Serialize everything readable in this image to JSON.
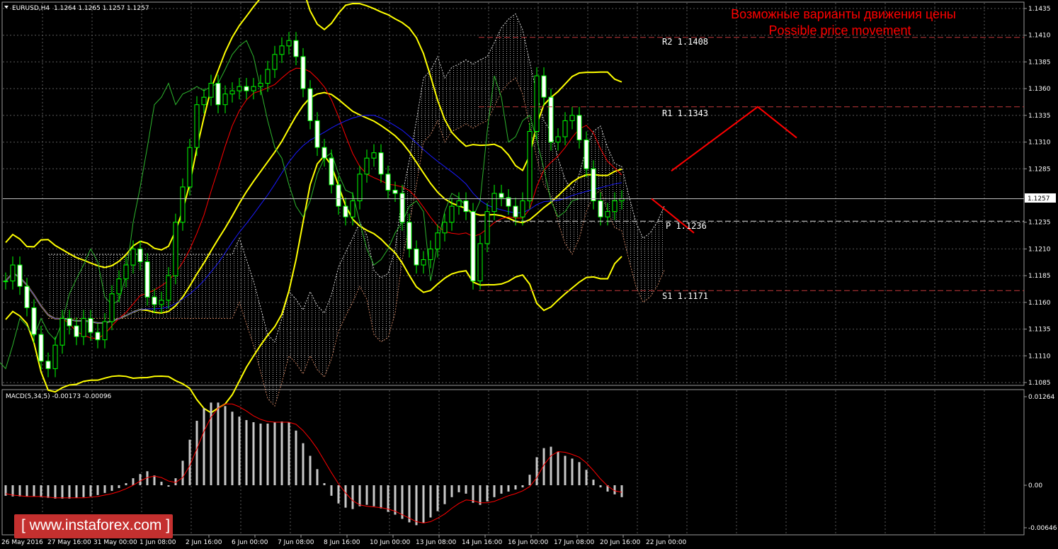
{
  "header": {
    "symbol": "EURUSD,H4",
    "ohlc": "1.1264 1.1265 1.1257 1.1257"
  },
  "annotation": {
    "line1": "Возможные варианты движения цены",
    "line2": "Possible price movement",
    "color": "#ff0000"
  },
  "levels": [
    {
      "name": "R2",
      "label": "R2  1.1408",
      "value": 1.1408
    },
    {
      "name": "R1",
      "label": "R1  1.1343",
      "value": 1.1343
    },
    {
      "name": "P",
      "label": "P  1.1236",
      "value": 1.1236
    },
    {
      "name": "S1",
      "label": "S1  1.1171",
      "value": 1.1171
    }
  ],
  "current_price": "1.1257",
  "macd_label": "MACD(5,34,5) -0.00173 -0.00096",
  "watermark": "[ www.instaforex.com ]",
  "chart_data": [
    {
      "type": "candlestick",
      "timeframe": "H4",
      "y_ticks": [
        "1.1435",
        "1.1410",
        "1.1385",
        "1.1360",
        "1.1335",
        "1.1310",
        "1.1285",
        "1.1257",
        "1.1235",
        "1.1210",
        "1.1185",
        "1.1160",
        "1.1135",
        "1.1110",
        "1.1085"
      ],
      "ylim": [
        1.1075,
        1.145
      ],
      "x_ticks": [
        "26 May 2016",
        "27 May 16:00",
        "31 May 00:00",
        "1 Jun 08:00",
        "2 Jun 16:00",
        "6 Jun 00:00",
        "7 Jun 08:00",
        "8 Jun 16:00",
        "10 Jun 00:00",
        "13 Jun 08:00",
        "14 Jun 16:00",
        "16 Jun 00:00",
        "17 Jun 08:00",
        "20 Jun 16:00",
        "22 Jun 00:00"
      ],
      "close_path": [
        1.118,
        1.1195,
        1.1175,
        1.1155,
        1.113,
        1.1105,
        1.1098,
        1.112,
        1.1145,
        1.1138,
        1.1128,
        1.1145,
        1.1132,
        1.1125,
        1.1142,
        1.1168,
        1.1182,
        1.1195,
        1.121,
        1.1198,
        1.1165,
        1.1158,
        1.1162,
        1.1185,
        1.1235,
        1.1268,
        1.1305,
        1.1345,
        1.1352,
        1.1365,
        1.1345,
        1.1355,
        1.1358,
        1.1362,
        1.1358,
        1.1362,
        1.1365,
        1.1378,
        1.1392,
        1.14,
        1.1405,
        1.139,
        1.136,
        1.133,
        1.1305,
        1.1295,
        1.127,
        1.125,
        1.124,
        1.1255,
        1.128,
        1.1295,
        1.13,
        1.128,
        1.1265,
        1.1262,
        1.1235,
        1.121,
        1.1195,
        1.12,
        1.121,
        1.1225,
        1.1235,
        1.125,
        1.1255,
        1.1245,
        1.118,
        1.1215,
        1.1245,
        1.1262,
        1.1258,
        1.125,
        1.124,
        1.1255,
        1.132,
        1.1372,
        1.1352,
        1.131,
        1.1315,
        1.133,
        1.1335,
        1.1312,
        1.1285,
        1.1255,
        1.124,
        1.1245,
        1.1255,
        1.1257
      ],
      "series": [
        {
          "name": "",
          "style": "bollinger",
          "color": "#ffff00"
        },
        {
          "name": "",
          "style": "tenkan-kijun",
          "color": "#ff0000"
        },
        {
          "name": "",
          "style": "tenkan-kijun",
          "color": "#0000ff"
        },
        {
          "name": "",
          "style": "chikou",
          "color": "#2db52d"
        }
      ],
      "forecast": [
        {
          "from": 1.1283,
          "to": 1.1343,
          "then": 1.1314
        },
        {
          "from": 1.1257,
          "to": 1.1225
        }
      ]
    },
    {
      "type": "bar",
      "y_ticks": [
        "0.01264",
        "0.00",
        "-0.00646"
      ],
      "ylim": [
        -0.0068,
        0.0128
      ],
      "values": [
        -0.0015,
        -0.0016,
        -0.0016,
        -0.0016,
        -0.0016,
        -0.0017,
        -0.0018,
        -0.0019,
        -0.0019,
        -0.0019,
        -0.0018,
        -0.0017,
        -0.0016,
        -0.0014,
        -0.0011,
        -0.0008,
        -0.0004,
        0.0003,
        0.001,
        0.0016,
        0.002,
        0.0014,
        0.0005,
        -0.0002,
        0.001,
        0.0035,
        0.0065,
        0.0092,
        0.011,
        0.0118,
        0.0118,
        0.0113,
        0.0105,
        0.0098,
        0.0093,
        0.009,
        0.0088,
        0.0088,
        0.009,
        0.0091,
        0.009,
        0.0078,
        0.006,
        0.0042,
        0.0023,
        0.0003,
        -0.0015,
        -0.0026,
        -0.0032,
        -0.0034,
        -0.003,
        -0.0028,
        -0.003,
        -0.0033,
        -0.0038,
        -0.0042,
        -0.0048,
        -0.0053,
        -0.0057,
        -0.0054,
        -0.0046,
        -0.0037,
        -0.0027,
        -0.0017,
        -0.001,
        -0.0012,
        -0.0025,
        -0.0028,
        -0.0023,
        -0.0017,
        -0.0012,
        -0.0009,
        -0.0006,
        -0.0003,
        0.0015,
        0.004,
        0.0053,
        0.0055,
        0.0048,
        0.0042,
        0.0038,
        0.0033,
        0.0022,
        0.0008,
        -0.0003,
        -0.0009,
        -0.0013,
        -0.0017
      ],
      "signal": [
        -0.0012,
        -0.0014,
        -0.0015,
        -0.0016,
        -0.0016,
        -0.0016,
        -0.0017,
        -0.0018,
        -0.0018,
        -0.0018,
        -0.0018,
        -0.0018,
        -0.0017,
        -0.0016,
        -0.0014,
        -0.0012,
        -0.0009,
        -0.0005,
        0.0,
        0.0006,
        0.0011,
        0.0013,
        0.0011,
        0.0006,
        0.0004,
        0.0011,
        0.0028,
        0.0052,
        0.0077,
        0.0097,
        0.011,
        0.0116,
        0.0116,
        0.0112,
        0.0106,
        0.0099,
        0.0094,
        0.0091,
        0.009,
        0.009,
        0.009,
        0.0087,
        0.0078,
        0.0066,
        0.0052,
        0.0035,
        0.0018,
        0.0002,
        -0.0011,
        -0.0022,
        -0.0028,
        -0.003,
        -0.0031,
        -0.0032,
        -0.0034,
        -0.0037,
        -0.0042,
        -0.0047,
        -0.0052,
        -0.0054,
        -0.0052,
        -0.0047,
        -0.0041,
        -0.0033,
        -0.0026,
        -0.0021,
        -0.0022,
        -0.0025,
        -0.0025,
        -0.0023,
        -0.0019,
        -0.0015,
        -0.0012,
        -0.0008,
        -0.0002,
        0.0011,
        0.0029,
        0.0042,
        0.0048,
        0.0047,
        0.0044,
        0.004,
        0.0032,
        0.0021,
        0.0009,
        -0.0001,
        -0.0008,
        -0.001
      ]
    }
  ]
}
